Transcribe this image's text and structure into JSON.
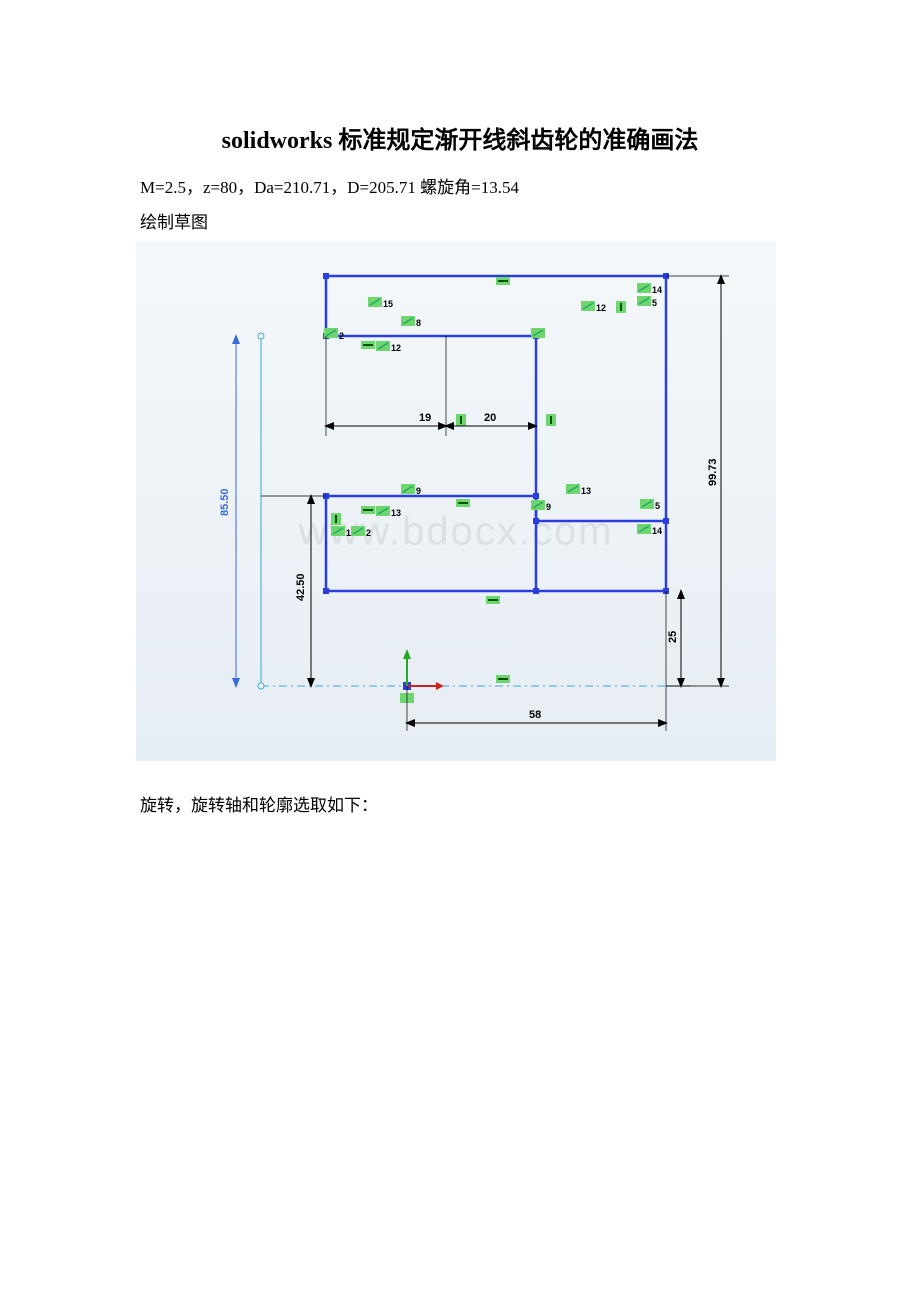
{
  "title": "solidworks 标准规定渐开线斜齿轮的准确画法",
  "params": "M=2.5，z=80，Da=210.71，D=205.71 螺旋角=13.54",
  "label_sketch": "绘制草图",
  "watermark": "www.bdocx.com",
  "label_below": "旋转，旋转轴和轮廓选取如下：",
  "dimensions": {
    "d19": "19",
    "d20": "20",
    "d58": "58",
    "d25": "25",
    "d42_5": "42.50",
    "d85_5": "85.50",
    "d99_73": "99.73"
  },
  "relations": [
    "2",
    "5",
    "8",
    "9",
    "12",
    "13",
    "14",
    "15"
  ]
}
